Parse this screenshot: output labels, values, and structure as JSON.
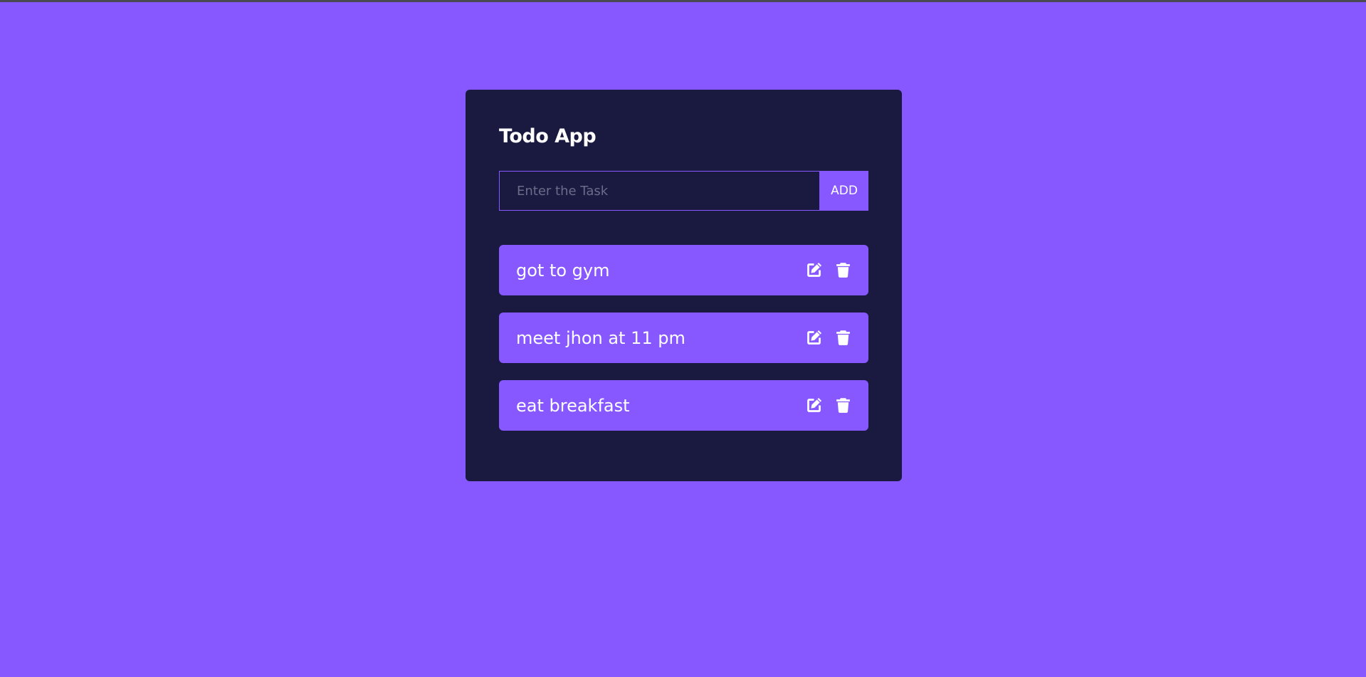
{
  "app": {
    "title": "Todo App"
  },
  "form": {
    "input_value": "",
    "input_placeholder": "Enter the Task",
    "add_label": "ADD"
  },
  "todos": [
    {
      "text": "got to gym",
      "edit_icon": "edit-icon",
      "delete_icon": "trash-icon"
    },
    {
      "text": "meet jhon at 11 pm",
      "edit_icon": "edit-icon",
      "delete_icon": "trash-icon"
    },
    {
      "text": "eat breakfast",
      "edit_icon": "edit-icon",
      "delete_icon": "trash-icon"
    }
  ],
  "colors": {
    "background": "#8758ff",
    "card": "#1a1a40",
    "accent": "#8758ff",
    "text": "#ffffff",
    "placeholder": "#6b6b8a"
  }
}
